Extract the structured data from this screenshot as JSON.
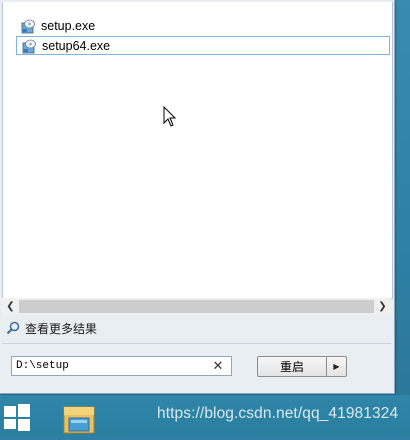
{
  "results": [
    {
      "label": "setup.exe",
      "icon": "setup-installer-icon",
      "selected": false
    },
    {
      "label": "setup64.exe",
      "icon": "setup-installer-icon",
      "selected": true
    }
  ],
  "more_results": {
    "label": "查看更多结果",
    "icon": "search-icon"
  },
  "search": {
    "value": "D:\\setup",
    "clear_icon": "close-icon"
  },
  "power": {
    "label": "重启",
    "arrow_icon": "triangle-right-icon"
  },
  "scrollbar": {
    "left_icon": "chevron-left-icon",
    "right_icon": "chevron-right-icon"
  },
  "taskbar": {
    "watermark": "https://blog.csdn.net/qq_41981324",
    "start_icon": "windows-logo-icon",
    "explorer_icon": "file-explorer-icon"
  },
  "colors": {
    "accent": "#2f7fa4",
    "selection_border": "#7db7da",
    "panel": "#e9eef3"
  }
}
